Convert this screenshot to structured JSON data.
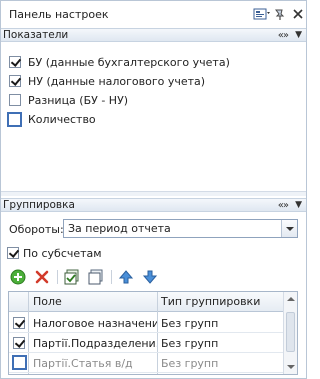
{
  "panel": {
    "title": "Панель настроек"
  },
  "indicators": {
    "header": "Показатели",
    "nav": "«»",
    "items": [
      {
        "label": "БУ (данные бухгалтерского учета)",
        "checked": true
      },
      {
        "label": "НУ (данные налогового учета)",
        "checked": true
      },
      {
        "label": "Разница (БУ - НУ)",
        "checked": false
      },
      {
        "label": "Количество",
        "checked": false
      }
    ]
  },
  "grouping": {
    "header": "Группировка",
    "nav": "«»",
    "turnover_label": "Обороты:",
    "turnover_value": "За период отчета",
    "by_subaccounts_label": "По субсчетам",
    "by_subaccounts_checked": true,
    "table": {
      "columns": [
        "Поле",
        "Тип группировки"
      ],
      "rows": [
        {
          "field": "Налоговое назначение",
          "type": "Без групп",
          "checked": true
        },
        {
          "field": "Партії.Подразделени...",
          "type": "Без групп",
          "checked": true
        },
        {
          "field": "Партії.Статья в/д",
          "type": "Без групп",
          "checked": false
        }
      ]
    }
  },
  "icons": [
    "settings-icon",
    "pin-icon",
    "close-icon",
    "add-icon",
    "delete-icon",
    "check-all-icon",
    "uncheck-all-icon",
    "move-up-icon",
    "move-down-icon"
  ]
}
